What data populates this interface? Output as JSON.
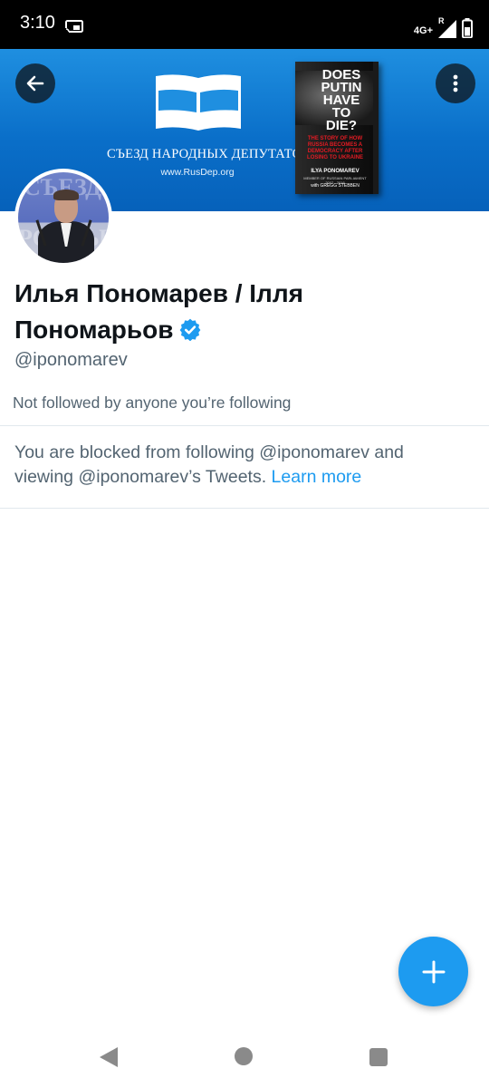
{
  "status_bar": {
    "time": "3:10",
    "network": "4G+",
    "roaming": "R",
    "icons": [
      "cast-icon",
      "signal-icon",
      "battery-icon"
    ]
  },
  "banner": {
    "logo_title": "СЪЕЗД НАРОДНЫХ ДЕПУТАТОВ",
    "logo_url": "www.RusDep.org",
    "book": {
      "title_line1": "DOES",
      "title_line2": "PUTIN",
      "title_line3": "HAVE TO",
      "title_line4": "DIE?",
      "subtitle": "THE STORY OF HOW RUSSIA BECOMES A DEMOCRACY AFTER LOSING TO UKRAINE",
      "author": "ILYA PONOMAREV",
      "author_note": "MEMBER OF RUSSIAN PARLIAMENT 2007 - 2016",
      "coauthor": "with GREGG STEBBEN"
    }
  },
  "profile": {
    "display_name": "Илья Пономарев / Ілля Пономарьов",
    "handle": "@iponomarev",
    "followers_note": "Not followed by anyone you’re following",
    "blocked_text": "You are blocked from following @iponomarev and viewing @iponomarev’s Tweets.",
    "learn_more": "Learn more"
  },
  "colors": {
    "accent": "#1d9bf0",
    "banner": "#0a6fc9",
    "secondary_text": "#536471"
  }
}
